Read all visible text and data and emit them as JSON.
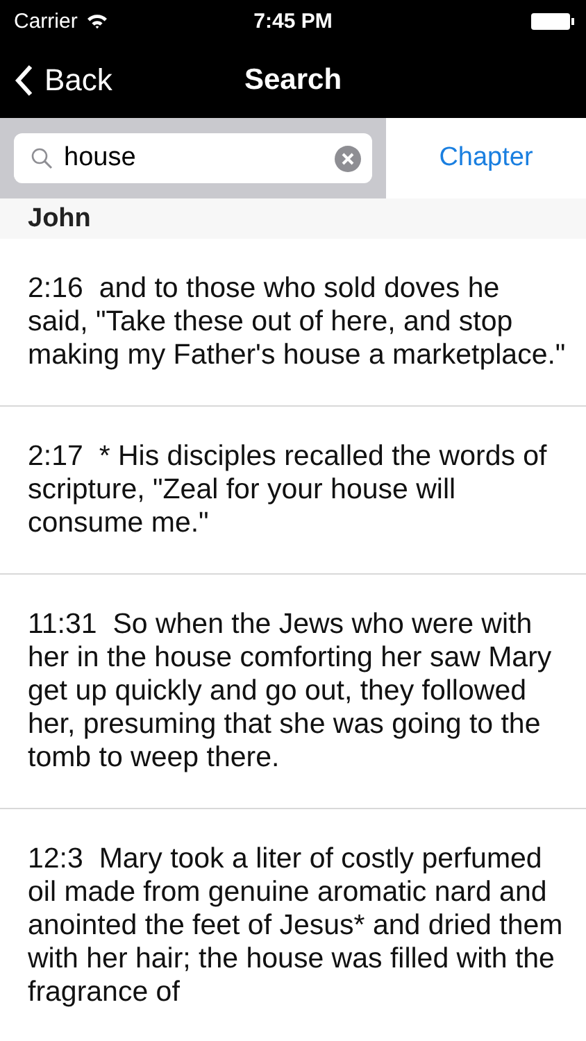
{
  "status_bar": {
    "carrier": "Carrier",
    "time": "7:45 PM"
  },
  "nav_bar": {
    "back": "Back",
    "title": "Search"
  },
  "search": {
    "value": "house",
    "scope_button": "Chapter"
  },
  "section": {
    "title": "John"
  },
  "results": [
    {
      "ref": "2:16",
      "text": "and to those who sold doves he said, \"Take these out of here, and stop making my Father's house a marketplace.\""
    },
    {
      "ref": "2:17",
      "text": "* His disciples recalled the words of scripture, \"Zeal for your house will consume me.\""
    },
    {
      "ref": "11:31",
      "text": "So when the Jews who were with her in the house comforting her saw Mary get up quickly and go out, they followed her, presuming that she was going to the tomb to weep there."
    },
    {
      "ref": "12:3",
      "text": "Mary took a liter of costly perfumed oil made from genuine aromatic nard and anointed the feet of Jesus* and dried them with her hair; the house was filled with the fragrance of"
    }
  ]
}
